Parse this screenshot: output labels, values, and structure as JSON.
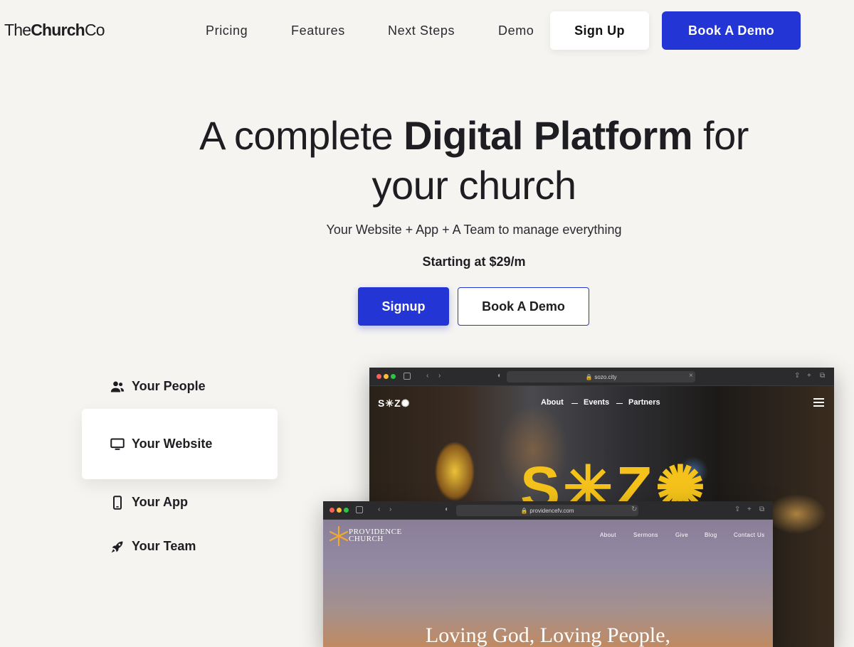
{
  "brand": {
    "logo_regular_1": "The",
    "logo_bold": "Church",
    "logo_regular_2": "Co"
  },
  "nav": {
    "links": [
      "Pricing",
      "Features",
      "Next Steps",
      "Demo"
    ],
    "signup_label": "Sign Up",
    "demo_label": "Book A Demo"
  },
  "hero": {
    "line1_pre": "A complete ",
    "line1_bold": "Digital Platform",
    "line1_post": " for",
    "line2": "your church",
    "subtitle": "Your Website + App + A Team to manage everything",
    "price": "Starting at $29/m",
    "signup_label": "Signup",
    "demo_label": "Book A Demo"
  },
  "features": {
    "items": [
      {
        "label": "Your People",
        "icon": "people-icon"
      },
      {
        "label": "Your Website",
        "icon": "monitor-icon",
        "selected": true
      },
      {
        "label": "Your App",
        "icon": "phone-icon"
      },
      {
        "label": "Your Team",
        "icon": "rocket-icon"
      }
    ]
  },
  "mockup_sozo": {
    "url": "sozo.city",
    "logo": "S✳Z✺",
    "nav": [
      "About",
      "Events",
      "Partners"
    ],
    "big_text": "S✳Z✺"
  },
  "mockup_providence": {
    "url": "providencefv.com",
    "logo_line1": "PROVIDENCE",
    "logo_line2": "CHURCH",
    "nav": [
      "About",
      "Sermons",
      "Give",
      "Blog",
      "Contact Us"
    ],
    "headline": "Loving God, Loving People,"
  },
  "colors": {
    "accent": "#2435d6",
    "background": "#f5f4f1",
    "sozo_yellow": "#f4c21a",
    "providence_logo": "#f0a830"
  }
}
